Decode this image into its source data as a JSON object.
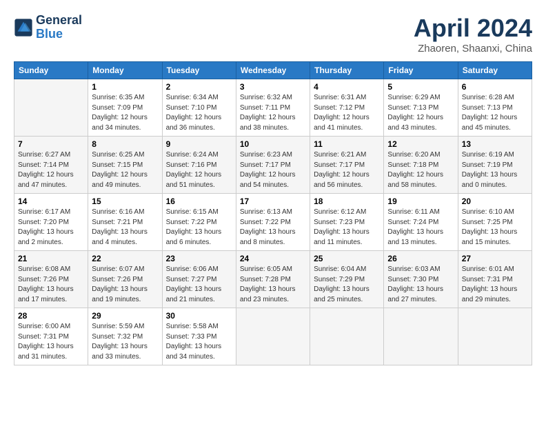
{
  "header": {
    "logo_line1": "General",
    "logo_line2": "Blue",
    "month": "April 2024",
    "location": "Zhaoren, Shaanxi, China"
  },
  "days_of_week": [
    "Sunday",
    "Monday",
    "Tuesday",
    "Wednesday",
    "Thursday",
    "Friday",
    "Saturday"
  ],
  "weeks": [
    [
      {
        "day": "",
        "info": ""
      },
      {
        "day": "1",
        "info": "Sunrise: 6:35 AM\nSunset: 7:09 PM\nDaylight: 12 hours\nand 34 minutes."
      },
      {
        "day": "2",
        "info": "Sunrise: 6:34 AM\nSunset: 7:10 PM\nDaylight: 12 hours\nand 36 minutes."
      },
      {
        "day": "3",
        "info": "Sunrise: 6:32 AM\nSunset: 7:11 PM\nDaylight: 12 hours\nand 38 minutes."
      },
      {
        "day": "4",
        "info": "Sunrise: 6:31 AM\nSunset: 7:12 PM\nDaylight: 12 hours\nand 41 minutes."
      },
      {
        "day": "5",
        "info": "Sunrise: 6:29 AM\nSunset: 7:13 PM\nDaylight: 12 hours\nand 43 minutes."
      },
      {
        "day": "6",
        "info": "Sunrise: 6:28 AM\nSunset: 7:13 PM\nDaylight: 12 hours\nand 45 minutes."
      }
    ],
    [
      {
        "day": "7",
        "info": "Sunrise: 6:27 AM\nSunset: 7:14 PM\nDaylight: 12 hours\nand 47 minutes."
      },
      {
        "day": "8",
        "info": "Sunrise: 6:25 AM\nSunset: 7:15 PM\nDaylight: 12 hours\nand 49 minutes."
      },
      {
        "day": "9",
        "info": "Sunrise: 6:24 AM\nSunset: 7:16 PM\nDaylight: 12 hours\nand 51 minutes."
      },
      {
        "day": "10",
        "info": "Sunrise: 6:23 AM\nSunset: 7:17 PM\nDaylight: 12 hours\nand 54 minutes."
      },
      {
        "day": "11",
        "info": "Sunrise: 6:21 AM\nSunset: 7:17 PM\nDaylight: 12 hours\nand 56 minutes."
      },
      {
        "day": "12",
        "info": "Sunrise: 6:20 AM\nSunset: 7:18 PM\nDaylight: 12 hours\nand 58 minutes."
      },
      {
        "day": "13",
        "info": "Sunrise: 6:19 AM\nSunset: 7:19 PM\nDaylight: 13 hours\nand 0 minutes."
      }
    ],
    [
      {
        "day": "14",
        "info": "Sunrise: 6:17 AM\nSunset: 7:20 PM\nDaylight: 13 hours\nand 2 minutes."
      },
      {
        "day": "15",
        "info": "Sunrise: 6:16 AM\nSunset: 7:21 PM\nDaylight: 13 hours\nand 4 minutes."
      },
      {
        "day": "16",
        "info": "Sunrise: 6:15 AM\nSunset: 7:22 PM\nDaylight: 13 hours\nand 6 minutes."
      },
      {
        "day": "17",
        "info": "Sunrise: 6:13 AM\nSunset: 7:22 PM\nDaylight: 13 hours\nand 8 minutes."
      },
      {
        "day": "18",
        "info": "Sunrise: 6:12 AM\nSunset: 7:23 PM\nDaylight: 13 hours\nand 11 minutes."
      },
      {
        "day": "19",
        "info": "Sunrise: 6:11 AM\nSunset: 7:24 PM\nDaylight: 13 hours\nand 13 minutes."
      },
      {
        "day": "20",
        "info": "Sunrise: 6:10 AM\nSunset: 7:25 PM\nDaylight: 13 hours\nand 15 minutes."
      }
    ],
    [
      {
        "day": "21",
        "info": "Sunrise: 6:08 AM\nSunset: 7:26 PM\nDaylight: 13 hours\nand 17 minutes."
      },
      {
        "day": "22",
        "info": "Sunrise: 6:07 AM\nSunset: 7:26 PM\nDaylight: 13 hours\nand 19 minutes."
      },
      {
        "day": "23",
        "info": "Sunrise: 6:06 AM\nSunset: 7:27 PM\nDaylight: 13 hours\nand 21 minutes."
      },
      {
        "day": "24",
        "info": "Sunrise: 6:05 AM\nSunset: 7:28 PM\nDaylight: 13 hours\nand 23 minutes."
      },
      {
        "day": "25",
        "info": "Sunrise: 6:04 AM\nSunset: 7:29 PM\nDaylight: 13 hours\nand 25 minutes."
      },
      {
        "day": "26",
        "info": "Sunrise: 6:03 AM\nSunset: 7:30 PM\nDaylight: 13 hours\nand 27 minutes."
      },
      {
        "day": "27",
        "info": "Sunrise: 6:01 AM\nSunset: 7:31 PM\nDaylight: 13 hours\nand 29 minutes."
      }
    ],
    [
      {
        "day": "28",
        "info": "Sunrise: 6:00 AM\nSunset: 7:31 PM\nDaylight: 13 hours\nand 31 minutes."
      },
      {
        "day": "29",
        "info": "Sunrise: 5:59 AM\nSunset: 7:32 PM\nDaylight: 13 hours\nand 33 minutes."
      },
      {
        "day": "30",
        "info": "Sunrise: 5:58 AM\nSunset: 7:33 PM\nDaylight: 13 hours\nand 34 minutes."
      },
      {
        "day": "",
        "info": ""
      },
      {
        "day": "",
        "info": ""
      },
      {
        "day": "",
        "info": ""
      },
      {
        "day": "",
        "info": ""
      }
    ]
  ]
}
